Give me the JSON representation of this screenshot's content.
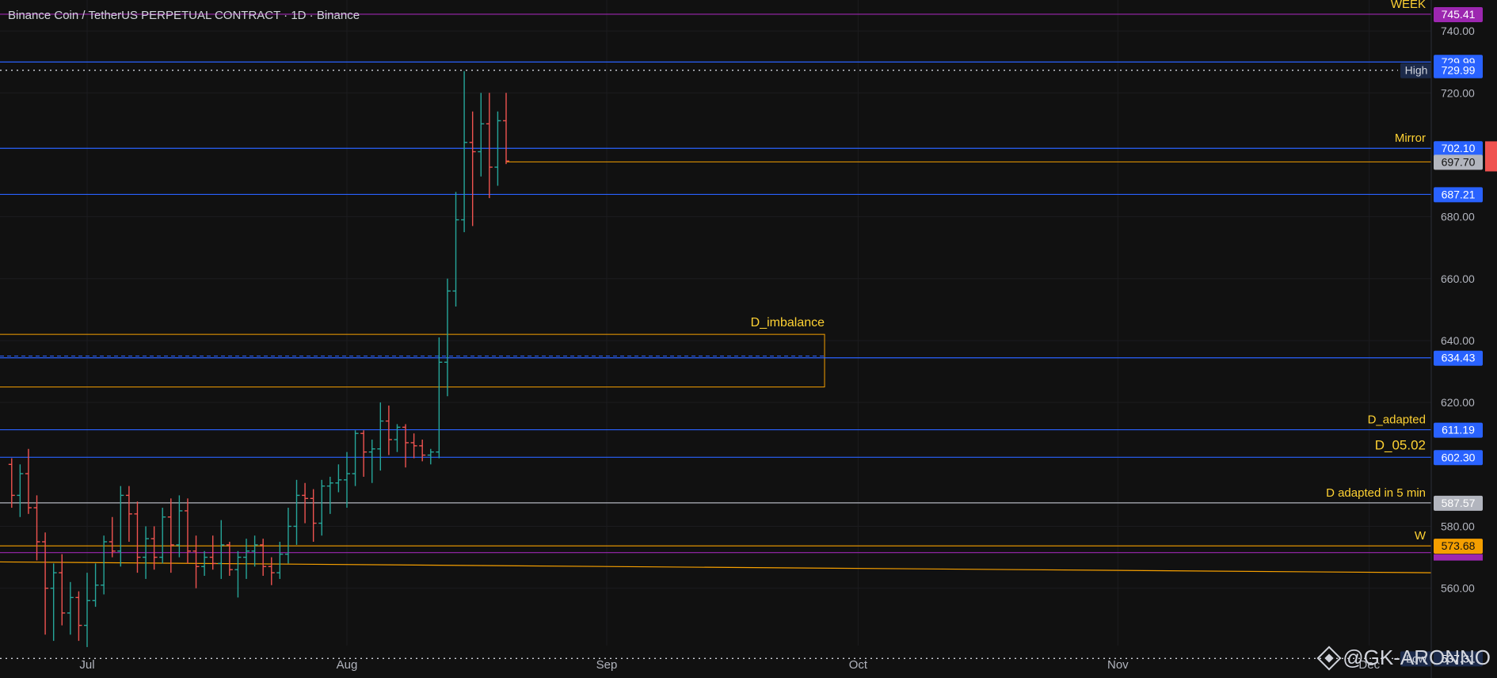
{
  "header": {
    "title": "Binance Coin / TetherUS PERPETUAL CONTRACT · 1D · Binance"
  },
  "watermark": {
    "text": "@GK-ARONNO",
    "icon": "binance-diamond-icon"
  },
  "colors": {
    "background": "#111111",
    "grid": "#1c1c1f",
    "up": "#26a69a",
    "down": "#ef5350",
    "blue_line": "#2962ff",
    "orange": "#f59f00",
    "yellow_label": "#ffd233",
    "purple": "#9c27b0",
    "gray_line": "#b2b5be",
    "axis_text": "#b2b5be"
  },
  "chart_data": {
    "type": "ohlc",
    "ylim": [
      531,
      750
    ],
    "y_ticks": [
      740,
      720,
      680,
      660,
      640,
      620,
      580,
      560
    ],
    "x_ticks": [
      {
        "label": "Jul",
        "day": 0
      },
      {
        "label": "Aug",
        "day": 31
      },
      {
        "label": "Sep",
        "day": 62
      },
      {
        "label": "Oct",
        "day": 92
      },
      {
        "label": "Nov",
        "day": 123
      },
      {
        "label": "Dec",
        "day": 153
      }
    ],
    "first_candle_day": -9,
    "candles": [
      [
        600,
        602,
        586,
        590
      ],
      [
        590,
        600,
        583,
        597
      ],
      [
        597,
        605,
        584,
        586
      ],
      [
        586,
        590,
        569,
        575
      ],
      [
        575,
        578,
        545,
        560
      ],
      [
        560,
        568,
        543,
        565
      ],
      [
        565,
        571,
        548,
        552
      ],
      [
        552,
        562,
        545,
        557
      ],
      [
        557,
        559,
        543,
        548
      ],
      [
        548,
        565,
        541,
        556
      ],
      [
        556,
        568,
        554,
        561
      ],
      [
        561,
        577,
        558,
        575
      ],
      [
        575,
        583,
        570,
        572
      ],
      [
        572,
        593,
        567,
        590
      ],
      [
        590,
        593,
        575,
        584
      ],
      [
        584,
        588,
        565,
        570
      ],
      [
        570,
        580,
        563,
        576
      ],
      [
        576,
        580,
        566,
        570
      ],
      [
        570,
        586,
        568,
        583
      ],
      [
        583,
        589,
        565,
        574
      ],
      [
        574,
        590,
        570,
        585
      ],
      [
        585,
        589,
        568,
        572
      ],
      [
        572,
        577,
        560,
        567
      ],
      [
        567,
        572,
        564,
        570
      ],
      [
        570,
        577,
        566,
        568
      ],
      [
        568,
        582,
        563,
        574
      ],
      [
        574,
        575,
        564,
        566
      ],
      [
        566,
        572,
        557,
        570
      ],
      [
        570,
        576,
        563,
        572
      ],
      [
        572,
        577,
        567,
        574
      ],
      [
        574,
        576,
        564,
        567
      ],
      [
        567,
        570,
        561,
        565
      ],
      [
        565,
        575,
        563,
        571
      ],
      [
        571,
        586,
        568,
        580
      ],
      [
        580,
        595,
        574,
        590
      ],
      [
        590,
        594,
        581,
        589
      ],
      [
        589,
        592,
        575,
        581
      ],
      [
        581,
        595,
        577,
        593
      ],
      [
        593,
        596,
        584,
        594
      ],
      [
        594,
        600,
        591,
        595
      ],
      [
        595,
        604,
        586,
        597
      ],
      [
        597,
        611,
        593,
        610
      ],
      [
        610,
        611,
        596,
        604
      ],
      [
        604,
        608,
        594,
        605
      ],
      [
        605,
        620,
        598,
        614
      ],
      [
        614,
        619,
        603,
        608
      ],
      [
        608,
        613,
        604,
        612
      ],
      [
        612,
        613,
        599,
        607
      ],
      [
        607,
        610,
        602,
        606
      ],
      [
        606,
        608,
        601,
        603
      ],
      [
        603,
        605,
        600,
        604
      ],
      [
        604,
        641,
        602,
        633
      ],
      [
        633,
        660,
        622,
        656
      ],
      [
        656,
        688,
        651,
        679
      ],
      [
        679,
        727,
        675,
        704
      ],
      [
        704,
        714,
        677,
        701
      ],
      [
        701,
        720,
        693,
        710
      ],
      [
        710,
        720,
        686,
        696
      ],
      [
        696,
        714,
        690,
        711
      ],
      [
        711,
        720,
        697,
        698
      ]
    ],
    "levels": [
      {
        "price": 745.41,
        "label": "745.41",
        "color": "#9c27b0",
        "style": "solid",
        "note": "WEEK",
        "note_color": "#ffd233"
      },
      {
        "price": 729.99,
        "label": "729.99",
        "color": "#2962ff",
        "style": "solid"
      },
      {
        "price": 702.1,
        "label": "702.10",
        "color": "#2962ff",
        "style": "solid",
        "note": "Mirror",
        "note_color": "#ffd233"
      },
      {
        "price": 687.21,
        "label": "687.21",
        "color": "#2962ff",
        "style": "solid"
      },
      {
        "price": 634.43,
        "label": "634.43",
        "color": "#2962ff",
        "style": "solid"
      },
      {
        "price": 611.19,
        "label": "611.19",
        "color": "#2962ff",
        "style": "solid",
        "note": "D_adapted",
        "note_color": "#ffd233"
      },
      {
        "price": 602.3,
        "label": "602.30",
        "color": "#2962ff",
        "style": "solid",
        "note": "D_05.02",
        "note_color": "#ffd233",
        "note_big": true
      },
      {
        "price": 587.57,
        "label": "587.57",
        "color": "#b2b5be",
        "style": "solid",
        "note": "D adapted in 5 min",
        "note_color": "#ffd233"
      },
      {
        "price": 573.68,
        "label": "573.68",
        "color": "#f59f00",
        "style": "solid",
        "note": "W",
        "note_color": "#ffd233",
        "label_text_color": "#111111"
      }
    ],
    "high": {
      "price": 727.3,
      "label": "729.99",
      "tag": "High"
    },
    "low": {
      "price": 537.31,
      "label": "537.31",
      "tag": "Low"
    },
    "last_price": {
      "price": 697.7,
      "label": "697.70"
    },
    "imbalance": {
      "label": "D_imbalance",
      "top": 642,
      "bottom": 625,
      "mid": 635,
      "end_day": 88
    },
    "trendline": {
      "start_price": 568.5,
      "end_price": 565
    }
  }
}
